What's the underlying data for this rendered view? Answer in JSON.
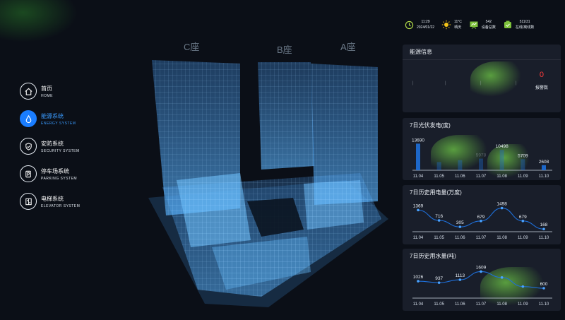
{
  "header": {
    "title": "",
    "subtitle": "",
    "time": "11:29",
    "date": "2024/01/22",
    "temperature": "11°C",
    "weather": "晴天",
    "device_total_value": "542",
    "device_total_label": "设备总数",
    "online_value": "511/31",
    "online_label": "在线/离线数"
  },
  "nav": [
    {
      "cn": "首页",
      "en": "HOME",
      "icon": "home-icon",
      "active": false
    },
    {
      "cn": "能源系统",
      "en": "ENERGY SYSTEM",
      "icon": "drop-icon",
      "active": true
    },
    {
      "cn": "安防系统",
      "en": "SECURITY SYSTEM",
      "icon": "shield-icon",
      "active": false
    },
    {
      "cn": "停车场系统",
      "en": "PARKING SYSTEM",
      "icon": "parking-icon",
      "active": false
    },
    {
      "cn": "电梯系统",
      "en": "ELEVATOR SYSTEM",
      "icon": "elevator-icon",
      "active": false
    }
  ],
  "buildings": {
    "c": "C座",
    "b": "B座",
    "a": "A座"
  },
  "energy": {
    "title": "能源信息",
    "alarm_value": "0",
    "alarm_label": "报警数"
  },
  "solar": {
    "title": "7日光伏发电(度)"
  },
  "power": {
    "title": "7日历史用电量(万度)"
  },
  "water": {
    "title": "7日历史用水量(吨)"
  },
  "chart_data": [
    {
      "type": "bar",
      "title": "7日光伏发电(度)",
      "categories": [
        "11.04",
        "11.05",
        "11.06",
        "11.07",
        "11.08",
        "11.09",
        "11.10"
      ],
      "values": [
        13690,
        4200,
        5200,
        5978,
        10498,
        5709,
        2608
      ],
      "labels": [
        "13690",
        "",
        "",
        "5978",
        "10498",
        "5709",
        "2608"
      ],
      "ylim": [
        0,
        16000
      ]
    },
    {
      "type": "line",
      "title": "7日历史用电量(万度)",
      "categories": [
        "11.04",
        "11.05",
        "11.06",
        "11.07",
        "11.08",
        "11.09",
        "11.10"
      ],
      "values": [
        1369,
        716,
        305,
        679,
        1498,
        679,
        168
      ],
      "labels": [
        "1369",
        "716",
        "305",
        "679",
        "1498",
        "679",
        "168"
      ],
      "ylim": [
        0,
        1700
      ]
    },
    {
      "type": "line",
      "title": "7日历史用水量(吨)",
      "categories": [
        "11.04",
        "11.05",
        "11.06",
        "11.07",
        "11.08",
        "11.09",
        "11.10"
      ],
      "values": [
        1026,
        937,
        1113,
        1609,
        1250,
        700,
        600
      ],
      "labels": [
        "1026",
        "937",
        "1113",
        "1609",
        "",
        "",
        "600"
      ],
      "ylim": [
        0,
        1800
      ]
    }
  ],
  "colors": {
    "accent": "#1a7dff",
    "alarm": "#ff3b3b",
    "line": "#1e6fd9"
  }
}
